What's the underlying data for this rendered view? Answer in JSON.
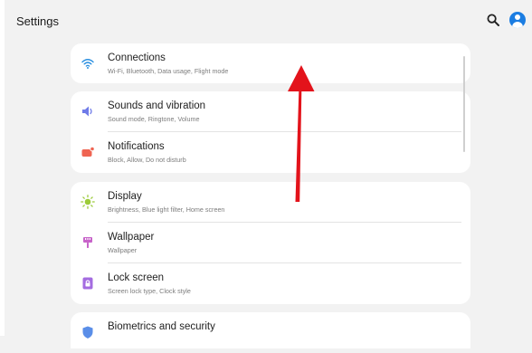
{
  "header": {
    "title": "Settings"
  },
  "colors": {
    "accent": "#1b7de2",
    "arrow": "#e3131b"
  },
  "cards": [
    {
      "items": [
        {
          "title": "Connections",
          "subtitle": "Wi-Fi, Bluetooth, Data usage, Flight mode",
          "icon": "wifi-icon"
        }
      ]
    },
    {
      "items": [
        {
          "title": "Sounds and vibration",
          "subtitle": "Sound mode, Ringtone, Volume",
          "icon": "speaker-icon"
        },
        {
          "title": "Notifications",
          "subtitle": "Block, Allow, Do not disturb",
          "icon": "notification-icon"
        }
      ]
    },
    {
      "items": [
        {
          "title": "Display",
          "subtitle": "Brightness, Blue light filter, Home screen",
          "icon": "sun-icon"
        },
        {
          "title": "Wallpaper",
          "subtitle": "Wallpaper",
          "icon": "brush-icon"
        },
        {
          "title": "Lock screen",
          "subtitle": "Screen lock type, Clock style",
          "icon": "lock-icon"
        }
      ]
    },
    {
      "items": [
        {
          "title": "Biometrics and security",
          "subtitle": "",
          "icon": "shield-icon"
        }
      ]
    }
  ]
}
